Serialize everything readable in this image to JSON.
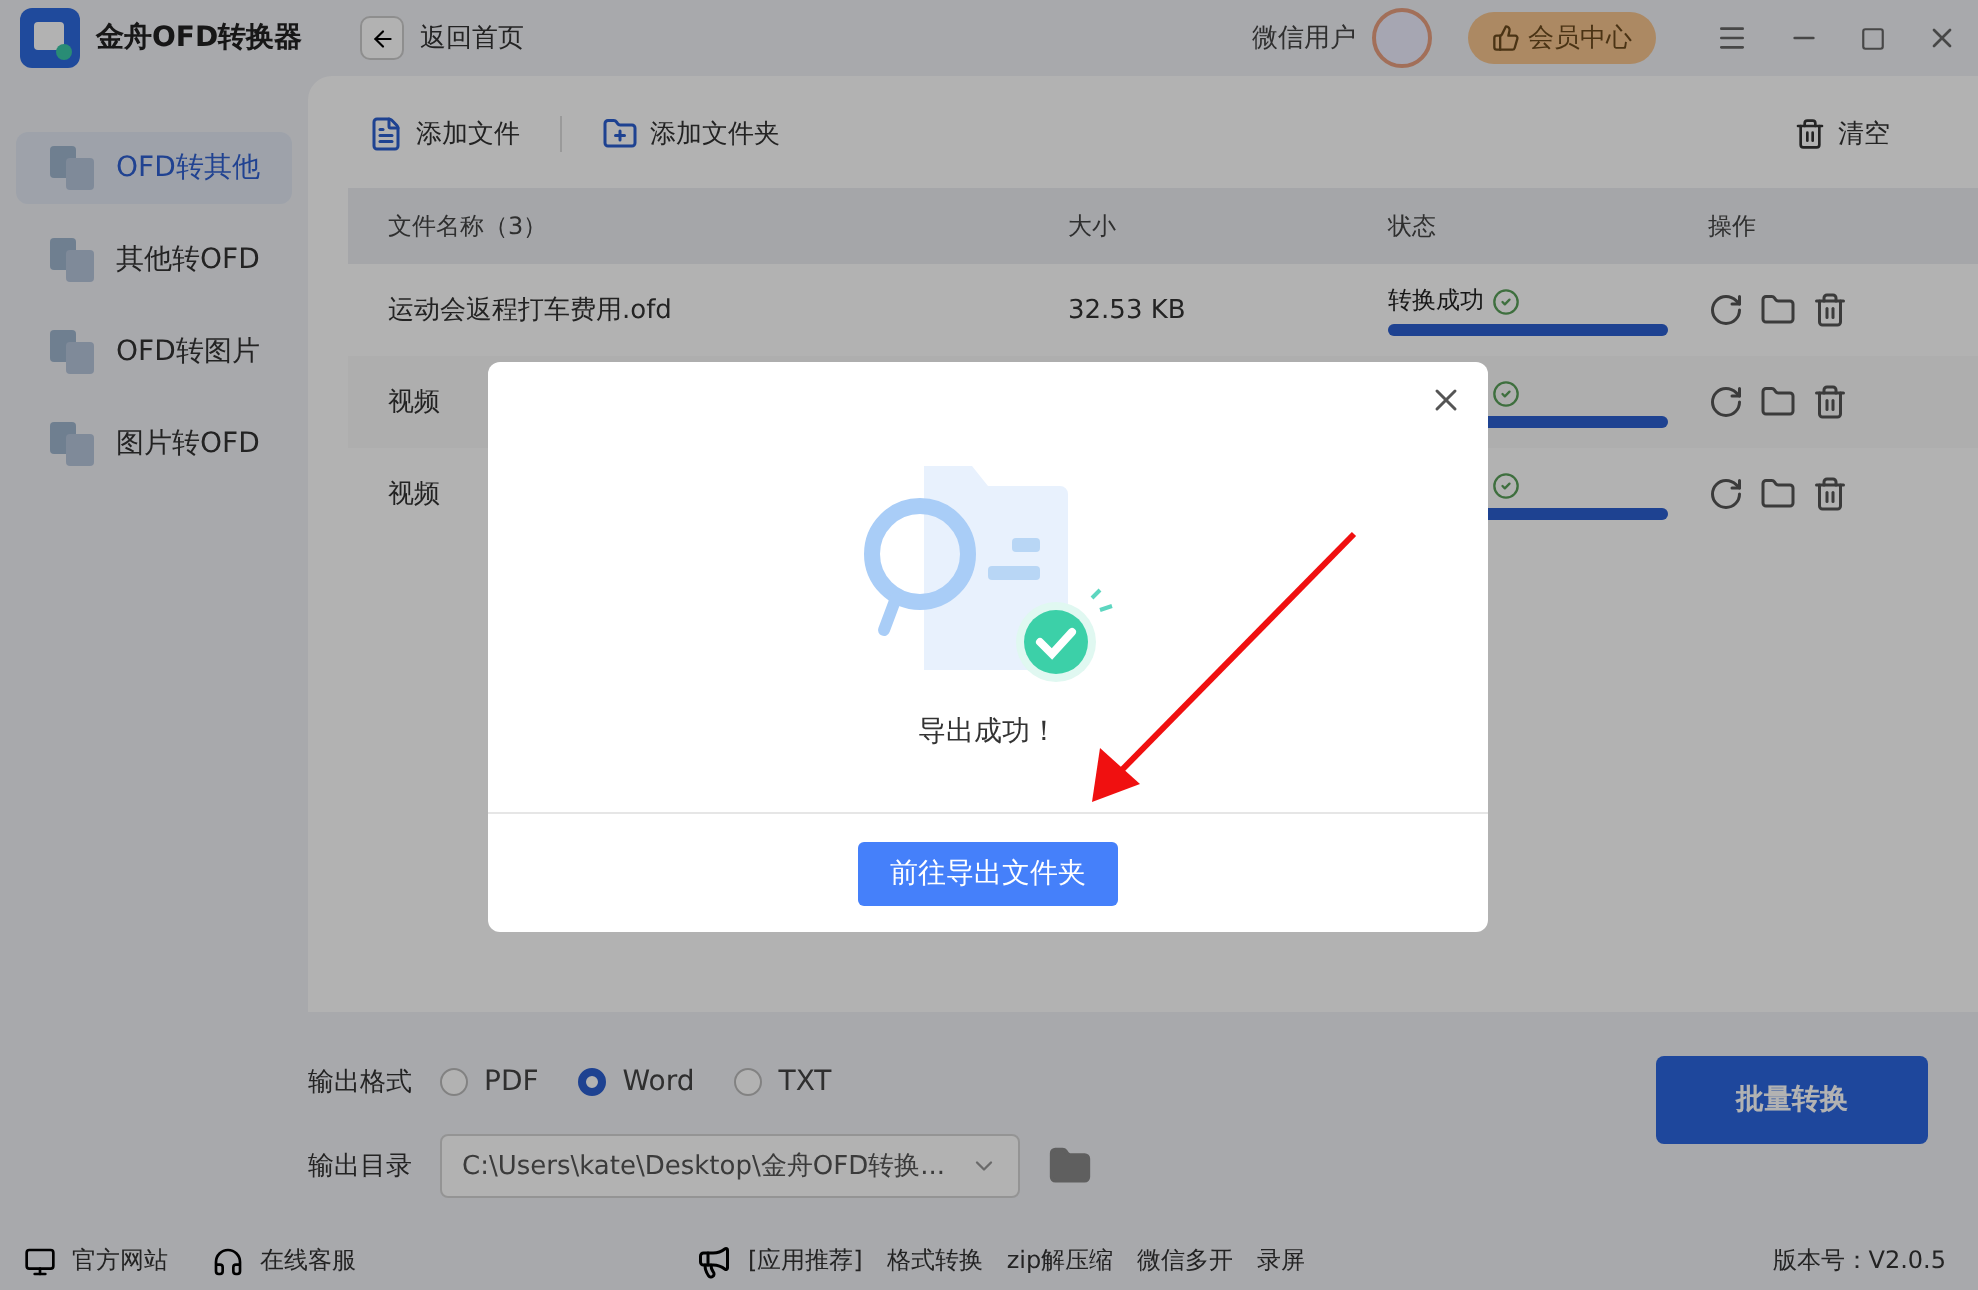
{
  "app": {
    "title": "金舟OFD转换器",
    "back": "返回首页",
    "user": "微信用户",
    "vip": "会员中心"
  },
  "sidebar": {
    "items": [
      {
        "label": "OFD转其他",
        "selected": true
      },
      {
        "label": "其他转OFD",
        "selected": false
      },
      {
        "label": "OFD转图片",
        "selected": false
      },
      {
        "label": "图片转OFD",
        "selected": false
      }
    ]
  },
  "toolbar": {
    "add_file": "添加文件",
    "add_folder": "添加文件夹",
    "clear": "清空"
  },
  "table": {
    "columns": [
      "文件名称（3）",
      "大小",
      "状态",
      "操作"
    ],
    "rows": [
      {
        "name": "运动会返程打车费用.ofd",
        "size": "32.53 KB",
        "status": "转换成功",
        "level": 1
      },
      {
        "name": "视频",
        "level": 1
      },
      {
        "name": "视频",
        "level": 1
      }
    ]
  },
  "output": {
    "format_label": "输出格式",
    "formats": [
      {
        "label": "PDF",
        "selected": false
      },
      {
        "label": "Word",
        "selected": true
      },
      {
        "label": "TXT",
        "selected": false
      }
    ],
    "dir_label": "输出目录",
    "dir": "C:\\Users\\kate\\Desktop\\金舟OFD转换...",
    "convert": "批量转换"
  },
  "footer": {
    "site": "官方网站",
    "service": "在线客服",
    "links": [
      "[应用推荐]",
      "格式转换",
      "zip解压缩",
      "微信多开",
      "录屏"
    ],
    "version": "版本号：V2.0.5"
  },
  "dialog": {
    "message": "导出成功！",
    "button": "前往导出文件夹"
  }
}
